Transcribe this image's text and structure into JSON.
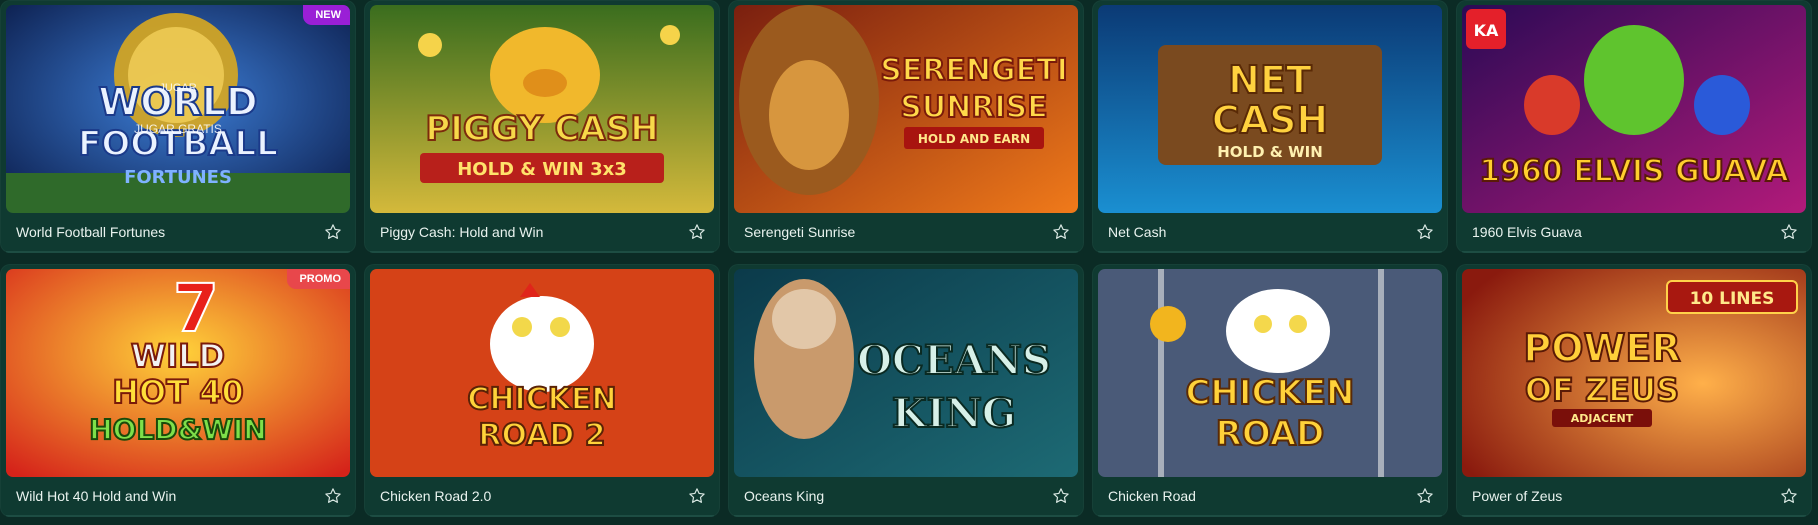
{
  "games": [
    {
      "title": "World Football Fortunes",
      "badge": "NEW",
      "art": [
        "WORLD",
        "FOOTBALL",
        "FORTUNES"
      ],
      "overlay": [
        "JUGAR",
        "JUGAR GRATIS"
      ]
    },
    {
      "title": "Piggy Cash: Hold and Win",
      "art": [
        "PIGGY CASH",
        "HOLD & WIN 3x3"
      ]
    },
    {
      "title": "Serengeti Sunrise",
      "art": [
        "SERENGETI",
        "SUNRISE",
        "HOLD AND EARN"
      ]
    },
    {
      "title": "Net Cash",
      "art": [
        "NET",
        "CASH",
        "HOLD & WIN"
      ]
    },
    {
      "title": "1960 Elvis Guava",
      "art": [
        "1960 ELVIS GUAVA",
        "KA"
      ]
    },
    {
      "title": "Wild Hot 40 Hold and Win",
      "badge": "PROMO",
      "art": [
        "7",
        "WILD",
        "HOT 40",
        "HOLD&WIN"
      ]
    },
    {
      "title": "Chicken Road 2.0",
      "art": [
        "CHICKEN",
        "ROAD 2"
      ]
    },
    {
      "title": "Oceans King",
      "art": [
        "OCEANS",
        "KING"
      ]
    },
    {
      "title": "Chicken Road",
      "art": [
        "CHICKEN",
        "ROAD"
      ]
    },
    {
      "title": "Power of Zeus",
      "art": [
        "10 LINES",
        "POWER",
        "OF ZEUS",
        "ADJACENT"
      ]
    }
  ],
  "colors": {
    "background": "#0b2b25",
    "card": "#0f3a31",
    "new_badge": "#9a1fd6",
    "promo_badge": "#e8474b"
  },
  "icons": {
    "favorite": "star-outline-icon"
  }
}
